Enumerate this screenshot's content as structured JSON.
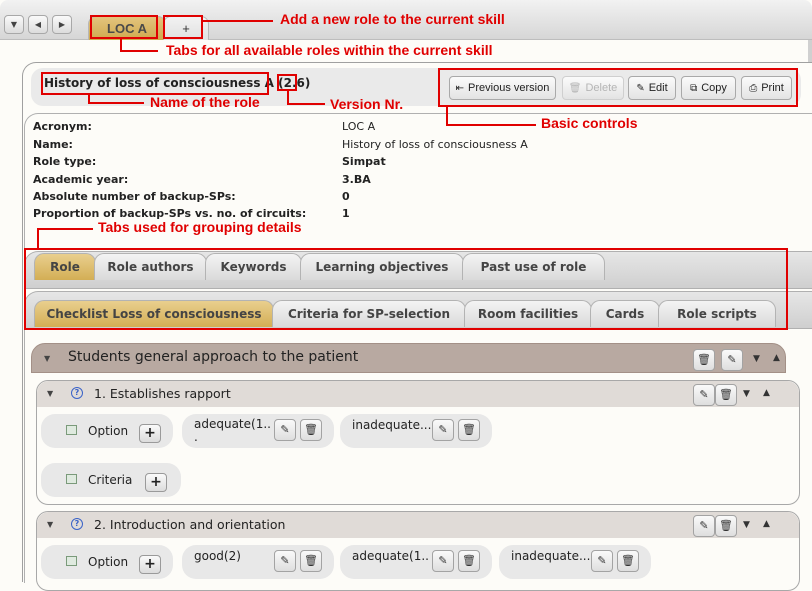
{
  "top_nav": {
    "role_tabs": [
      {
        "label": "LOC A",
        "active": true
      }
    ],
    "add_tab_label": "+"
  },
  "role": {
    "title": "History of loss of consciousness A",
    "version_open": "(",
    "version": "2.6",
    "version_close": ")"
  },
  "controls": {
    "previous_version": "Previous version",
    "delete": "Delete",
    "edit": "Edit",
    "copy": "Copy",
    "print": "Print"
  },
  "details": [
    {
      "label": "Acronym:",
      "value": "LOC A",
      "bold": false
    },
    {
      "label": "Name:",
      "value": "History of loss of consciousness A",
      "bold": false
    },
    {
      "label": "Role type:",
      "value": "Simpat",
      "bold": true
    },
    {
      "label": "Academic year:",
      "value": "3.BA",
      "bold": true
    },
    {
      "label": "Absolute number of backup-SPs:",
      "value": "0",
      "bold": true
    },
    {
      "label": "Proportion of backup-SPs vs. no. of circuits:",
      "value": "1",
      "bold": true
    }
  ],
  "tabs_primary": [
    {
      "label": "Role",
      "active": true
    },
    {
      "label": "Role authors",
      "active": false
    },
    {
      "label": "Keywords",
      "active": false
    },
    {
      "label": "Learning objectives",
      "active": false
    },
    {
      "label": "Past use of role",
      "active": false
    }
  ],
  "tabs_secondary": [
    {
      "label": "Checklist Loss of consciousness",
      "active": true
    },
    {
      "label": "Criteria for SP-selection",
      "active": false
    },
    {
      "label": "Room facilities",
      "active": false
    },
    {
      "label": "Cards",
      "active": false
    },
    {
      "label": "Role scripts",
      "active": false
    }
  ],
  "checklist": {
    "topic": "Students general approach to the patient",
    "questions": [
      {
        "title": "1. Establishes rapport",
        "option_label": "Option",
        "options": [
          "adequate(1..\n.",
          "inadequate..."
        ],
        "criteria_label": "Criteria"
      },
      {
        "title": "2. Introduction and orientation",
        "option_label": "Option",
        "options": [
          "good(2)",
          "adequate(1..",
          "inadequate..."
        ]
      }
    ]
  },
  "annotations": {
    "add_role": "Add a new role to the current skill",
    "role_tabs": "Tabs for all available roles within the current skill",
    "role_name": "Name of the role",
    "version_nr": "Version Nr.",
    "basic_controls": "Basic controls",
    "grouping_tabs": "Tabs used for grouping details"
  },
  "colors": {
    "annotation": "#e00000",
    "active_tab": "#d3ae55",
    "topic_header": "#b8a9a1"
  }
}
